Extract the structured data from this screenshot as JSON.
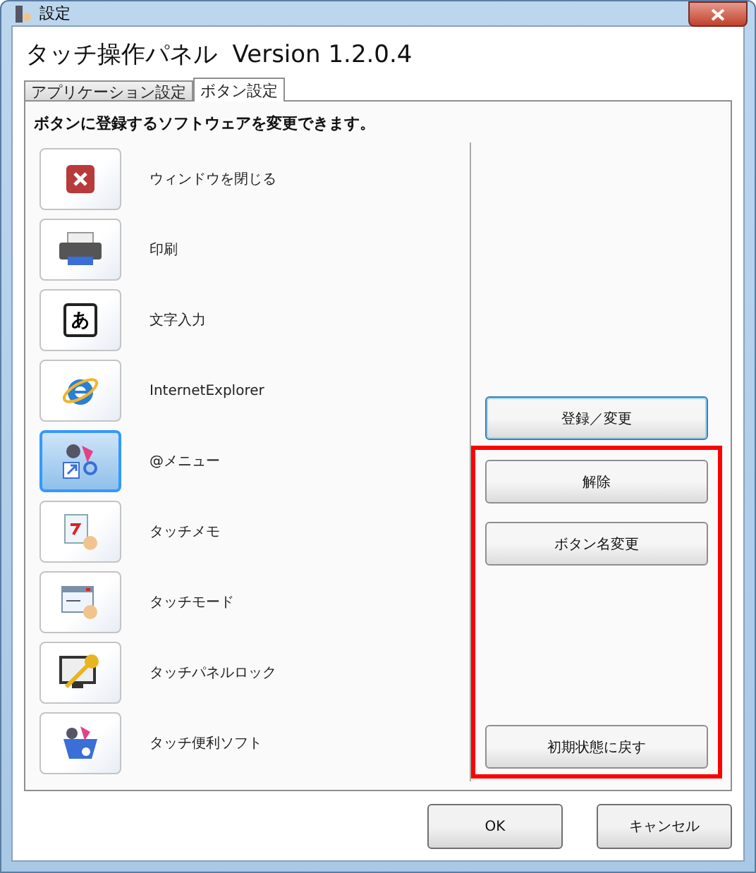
{
  "window": {
    "title": "設定"
  },
  "header": "タッチ操作パネル  Version 1.2.0.4",
  "tabs": [
    {
      "label": "アプリケーション設定",
      "selected": false
    },
    {
      "label": "ボタン設定",
      "selected": true
    }
  ],
  "instruction": "ボタンに登録するソフトウェアを変更できます。",
  "items": [
    {
      "label": "ウィンドウを閉じる",
      "kind": "close",
      "selected": false
    },
    {
      "label": "印刷",
      "kind": "printer",
      "selected": false
    },
    {
      "label": "文字入力",
      "kind": "kana",
      "text_icon": "あ",
      "selected": false
    },
    {
      "label": "InternetExplorer",
      "kind": "browser",
      "selected": false
    },
    {
      "label": "@メニュー",
      "kind": "menu",
      "selected": true
    },
    {
      "label": "タッチメモ",
      "kind": "memo",
      "selected": false
    },
    {
      "label": "タッチモード",
      "kind": "mode",
      "selected": false
    },
    {
      "label": "タッチパネルロック",
      "kind": "lock",
      "selected": false
    },
    {
      "label": "タッチ便利ソフト",
      "kind": "tools",
      "selected": false
    }
  ],
  "register_button": {
    "label": "登録／変更",
    "focused": true
  },
  "highlighted_buttons": [
    {
      "label": "解除",
      "kind": "top"
    },
    {
      "label": "ボタン名変更",
      "kind": "top"
    },
    {
      "label": "初期状態に戻す",
      "kind": "bottom"
    }
  ],
  "dialog_buttons": [
    "OK",
    "キャンセル"
  ]
}
